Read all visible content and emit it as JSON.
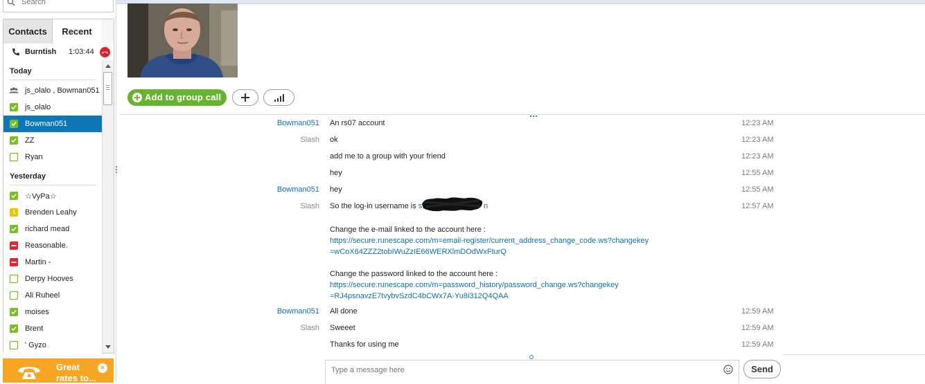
{
  "search": {
    "placeholder": "Search"
  },
  "tabs": [
    {
      "label": "Contacts"
    },
    {
      "label": "Recent"
    }
  ],
  "active_call": {
    "name": "Burntish",
    "duration": "1:03:44"
  },
  "groups": {
    "today": "Today",
    "yesterday": "Yesterday"
  },
  "contacts_today": [
    {
      "name": "js_olalo , Bowman051",
      "status": "group"
    },
    {
      "name": "js_olalo",
      "status": "online"
    },
    {
      "name": "Bowman051",
      "status": "online"
    },
    {
      "name": "ZZ",
      "status": "online"
    },
    {
      "name": "Ryan",
      "status": "offline"
    }
  ],
  "contacts_yesterday": [
    {
      "name": "☆VyPa☆",
      "status": "online"
    },
    {
      "name": "Brenden Leahy",
      "status": "away"
    },
    {
      "name": "richard mead",
      "status": "online"
    },
    {
      "name": "Reasonable.",
      "status": "dnd"
    },
    {
      "name": "Martin  -",
      "status": "dnd"
    },
    {
      "name": "Derpy Hooves",
      "status": "offline"
    },
    {
      "name": "Ali Ruheel",
      "status": "offline"
    },
    {
      "name": "moises",
      "status": "online"
    },
    {
      "name": "Brent",
      "status": "online"
    },
    {
      "name": "'  Gyzo",
      "status": "offline"
    }
  ],
  "promo": {
    "line1": "Great",
    "line2": "rates to..."
  },
  "call_actions": {
    "add_to_group_call": "Add to group call"
  },
  "messages": [
    {
      "sender": "Bowman051",
      "text": "An rs07 account",
      "time": "12:23 AM"
    },
    {
      "sender": "Slash",
      "text": "ok",
      "time": "12:23 AM"
    },
    {
      "sender": "",
      "text": "add me to a group with your friend",
      "time": "12:23 AM"
    },
    {
      "sender": "",
      "text": "hey",
      "time": "12:55 AM"
    },
    {
      "sender": "Bowman051",
      "text": "hey",
      "time": "12:55 AM"
    },
    {
      "sender": "Slash",
      "text": "So the log-in username is ",
      "link": "s",
      "link_tail": "n",
      "time": "12:57 AM"
    },
    {
      "sender": "Bowman051",
      "text": "All done",
      "time": "12:59 AM"
    },
    {
      "sender": "Slash",
      "text": "Sweeet",
      "time": "12:59 AM"
    },
    {
      "sender": "",
      "text": "Thanks for using me",
      "time": "12:59 AM"
    }
  ],
  "links_block": {
    "email_intro": "Change the e-mail linked to the account here :",
    "email_url_1": "https://secure.runescape.com/m=email-register/current_address_change_code.ws?changekey",
    "email_url_2": "=wCoX64ZZZ2tobIWuZzIE66WERXlmDOdWxFturQ",
    "password_intro": "Change the password linked to the account here :",
    "password_url_1": "https://secure.runescape.com/m=password_history/password_change.ws?changekey",
    "password_url_2": "=RJ4psnavzE7tvybvSzdC4bCWx7A-Yu8i312Q4QAA"
  },
  "composer": {
    "placeholder": "Type a message here",
    "send": "Send"
  }
}
